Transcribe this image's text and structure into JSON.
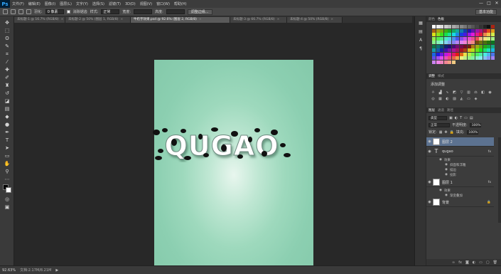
{
  "app": {
    "logo": "Ps"
  },
  "menu": [
    "文件(F)",
    "编辑(E)",
    "图像(I)",
    "图层(L)",
    "文字(Y)",
    "选择(S)",
    "滤镜(T)",
    "3D(D)",
    "视图(V)",
    "窗口(W)",
    "帮助(H)"
  ],
  "window_controls": [
    "—",
    "□",
    "✕"
  ],
  "options": {
    "feather_label": "羽化:",
    "feather_value": "0 像素",
    "antialias_label": "消除锯齿",
    "style_label": "样式:",
    "style_value": "正常",
    "width_label": "宽度:",
    "height_label": "高度:",
    "refine_button": "调整边缘...",
    "workspace": "基本功能"
  },
  "tabs": [
    {
      "label": "未标题-1 @ 16.7% (RGB/8)",
      "active": false
    },
    {
      "label": "未标题-2 @ 50% (图层 1, RGB/8)",
      "active": false
    },
    {
      "label": "牛奶字效果.psd @ 92.6% (图层 2, RGB/8)",
      "active": true
    },
    {
      "label": "未标题-3 @ 66.7% (RGB/8)",
      "active": false
    },
    {
      "label": "未标题-4 @ 50% (RGB/8)",
      "active": false
    }
  ],
  "canvas": {
    "text": "QUGAO",
    "gradient_colors": [
      "#e8f6ee",
      "#84c9aa"
    ]
  },
  "status": {
    "zoom": "92.63%",
    "info": "文档:2.17M/8.21M"
  },
  "panels": {
    "swatches_tabs": [
      "颜色",
      "色板"
    ],
    "adjust_tabs": [
      "调整",
      "样式"
    ],
    "adjust_title": "添加调整",
    "layers_tabs": [
      "图层",
      "通道",
      "路径"
    ],
    "kind_label": "类型",
    "blend_mode": "正常",
    "opacity_label": "不透明度:",
    "opacity_value": "100%",
    "lock_label": "锁定:",
    "fill_label": "填充:",
    "fill_value": "100%",
    "layers": [
      {
        "name": "图层 2",
        "type": "raster",
        "selected": true,
        "fx": ""
      },
      {
        "name": "qugao",
        "type": "text",
        "selected": false,
        "fx": "fx"
      },
      {
        "name": "图层 1",
        "type": "raster",
        "selected": false,
        "fx": "fx"
      },
      {
        "name": "背景",
        "type": "background",
        "selected": false,
        "fx": ""
      }
    ],
    "text_effects": [
      "效果",
      "斜面和浮雕",
      "描边",
      "投影"
    ],
    "layer1_effects": [
      "效果",
      "渐变叠加"
    ]
  },
  "colors": {
    "accent_selected": "#5c7290",
    "panel_bg": "#3c3c3c",
    "app_bg": "#282828"
  }
}
